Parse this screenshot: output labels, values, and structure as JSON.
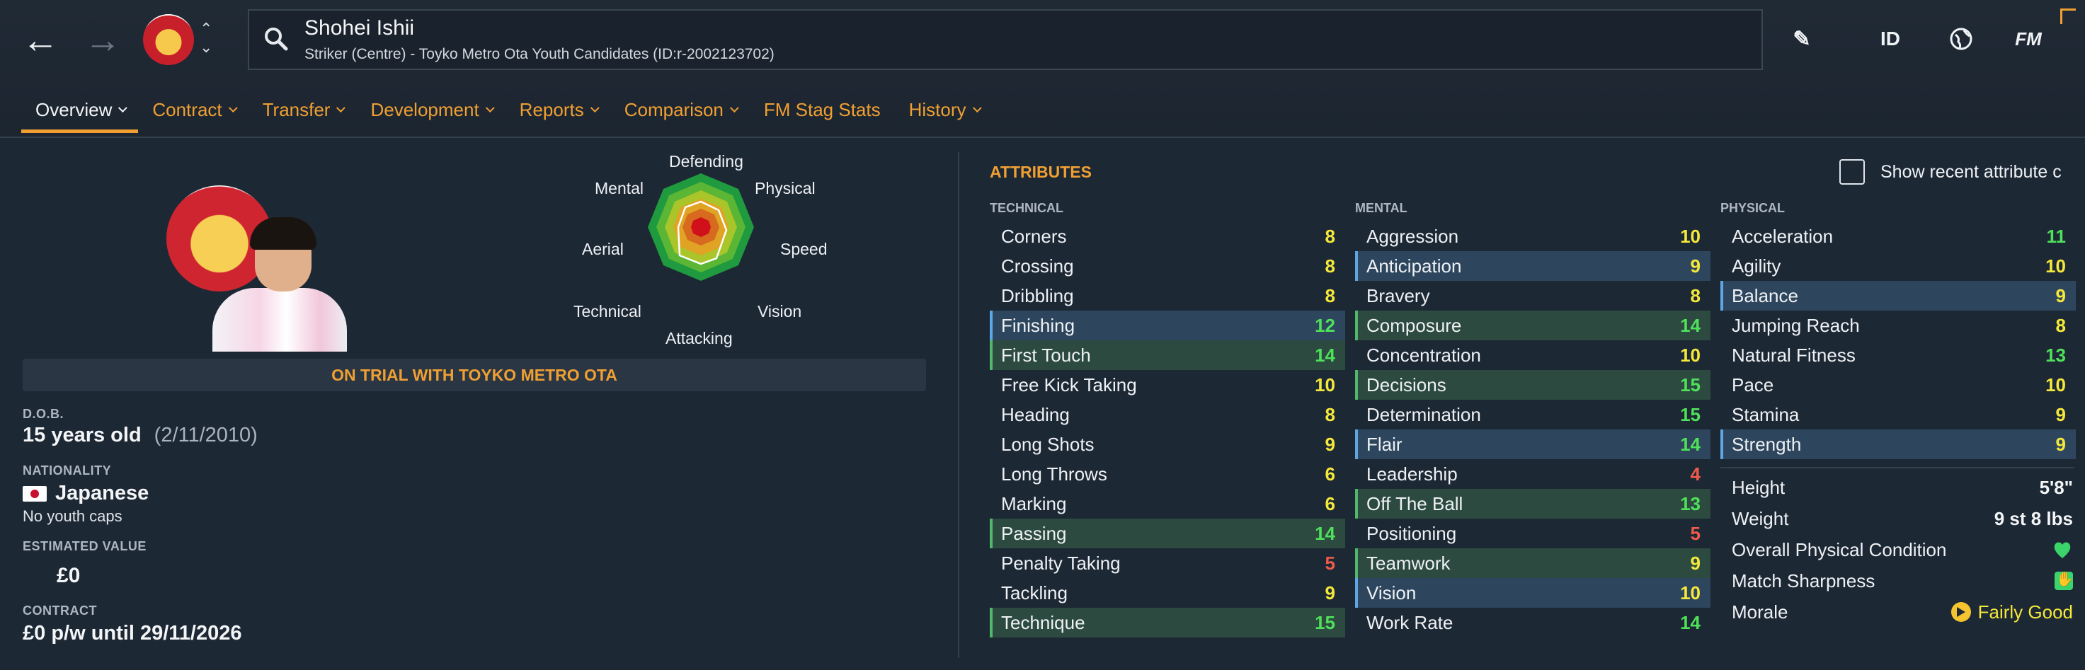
{
  "header": {
    "player_name": "Shohei Ishii",
    "player_subtitle": "Striker (Centre) - Toyko Metro Ota Youth Candidates (ID:r-2002123702)",
    "id_label": "ID",
    "fm_label": "FM",
    "tabs": [
      {
        "label": "Overview",
        "active": true,
        "dropdown": true
      },
      {
        "label": "Contract",
        "dropdown": true
      },
      {
        "label": "Transfer",
        "dropdown": true
      },
      {
        "label": "Development",
        "dropdown": true
      },
      {
        "label": "Reports",
        "dropdown": true
      },
      {
        "label": "Comparison",
        "dropdown": true
      },
      {
        "label": "FM Stag Stats",
        "dropdown": false
      },
      {
        "label": "History",
        "dropdown": true
      }
    ]
  },
  "radar": {
    "labels": {
      "defending": "Defending",
      "physical": "Physical",
      "speed": "Speed",
      "vision": "Vision",
      "attacking": "Attacking",
      "technical": "Technical",
      "aerial": "Aerial",
      "mental": "Mental"
    }
  },
  "profile": {
    "trial_banner": "ON TRIAL WITH TOYKO METRO OTA",
    "dob_label": "D.O.B.",
    "age": "15 years old",
    "dob": "(2/11/2010)",
    "nationality_label": "NATIONALITY",
    "nationality": "Japanese",
    "youth_caps": "No youth caps",
    "value_label": "ESTIMATED VALUE",
    "value": "£0",
    "contract_label": "CONTRACT",
    "contract": "£0 p/w until 29/11/2026"
  },
  "attributes": {
    "title": "ATTRIBUTES",
    "recent_toggle": "Show recent attribute c",
    "technical": {
      "heading": "TECHNICAL",
      "items": [
        {
          "name": "Corners",
          "value": "8",
          "hl": ""
        },
        {
          "name": "Crossing",
          "value": "8",
          "hl": ""
        },
        {
          "name": "Dribbling",
          "value": "8",
          "hl": ""
        },
        {
          "name": "Finishing",
          "value": "12",
          "hl": "blue"
        },
        {
          "name": "First Touch",
          "value": "14",
          "hl": "green"
        },
        {
          "name": "Free Kick Taking",
          "value": "10",
          "hl": ""
        },
        {
          "name": "Heading",
          "value": "8",
          "hl": ""
        },
        {
          "name": "Long Shots",
          "value": "9",
          "hl": ""
        },
        {
          "name": "Long Throws",
          "value": "6",
          "hl": ""
        },
        {
          "name": "Marking",
          "value": "6",
          "hl": ""
        },
        {
          "name": "Passing",
          "value": "14",
          "hl": "green"
        },
        {
          "name": "Penalty Taking",
          "value": "5",
          "hl": ""
        },
        {
          "name": "Tackling",
          "value": "9",
          "hl": ""
        },
        {
          "name": "Technique",
          "value": "15",
          "hl": "green"
        }
      ]
    },
    "mental": {
      "heading": "MENTAL",
      "items": [
        {
          "name": "Aggression",
          "value": "10",
          "hl": ""
        },
        {
          "name": "Anticipation",
          "value": "9",
          "hl": "blue"
        },
        {
          "name": "Bravery",
          "value": "8",
          "hl": ""
        },
        {
          "name": "Composure",
          "value": "14",
          "hl": "green"
        },
        {
          "name": "Concentration",
          "value": "10",
          "hl": ""
        },
        {
          "name": "Decisions",
          "value": "15",
          "hl": "green"
        },
        {
          "name": "Determination",
          "value": "15",
          "hl": ""
        },
        {
          "name": "Flair",
          "value": "14",
          "hl": "blue"
        },
        {
          "name": "Leadership",
          "value": "4",
          "hl": ""
        },
        {
          "name": "Off The Ball",
          "value": "13",
          "hl": "green"
        },
        {
          "name": "Positioning",
          "value": "5",
          "hl": ""
        },
        {
          "name": "Teamwork",
          "value": "9",
          "hl": "green"
        },
        {
          "name": "Vision",
          "value": "10",
          "hl": "blue"
        },
        {
          "name": "Work Rate",
          "value": "14",
          "hl": ""
        }
      ]
    },
    "physical": {
      "heading": "PHYSICAL",
      "items": [
        {
          "name": "Acceleration",
          "value": "11",
          "hl": ""
        },
        {
          "name": "Agility",
          "value": "10",
          "hl": ""
        },
        {
          "name": "Balance",
          "value": "9",
          "hl": "blue"
        },
        {
          "name": "Jumping Reach",
          "value": "8",
          "hl": ""
        },
        {
          "name": "Natural Fitness",
          "value": "13",
          "hl": ""
        },
        {
          "name": "Pace",
          "value": "10",
          "hl": ""
        },
        {
          "name": "Stamina",
          "value": "9",
          "hl": ""
        },
        {
          "name": "Strength",
          "value": "9",
          "hl": "blue"
        }
      ]
    },
    "details": {
      "height_label": "Height",
      "height": "5'8\"",
      "weight_label": "Weight",
      "weight": "9 st 8 lbs",
      "condition_label": "Overall Physical Condition",
      "sharpness_label": "Match Sharpness",
      "morale_label": "Morale",
      "morale": "Fairly Good"
    }
  },
  "colors": {
    "accent": "#f0a033",
    "value_low": "#f05a4a",
    "value_mid": "#f4e83a",
    "value_high": "#4fe15a",
    "highlight_green": "#2c4a3f",
    "highlight_blue": "#2e465d"
  },
  "icons": [
    "back-arrow-icon",
    "forward-arrow-icon",
    "search-icon",
    "edit-pencil-icon",
    "globe-icon",
    "heart-icon",
    "thumb-icon",
    "morale-arrow-icon"
  ]
}
